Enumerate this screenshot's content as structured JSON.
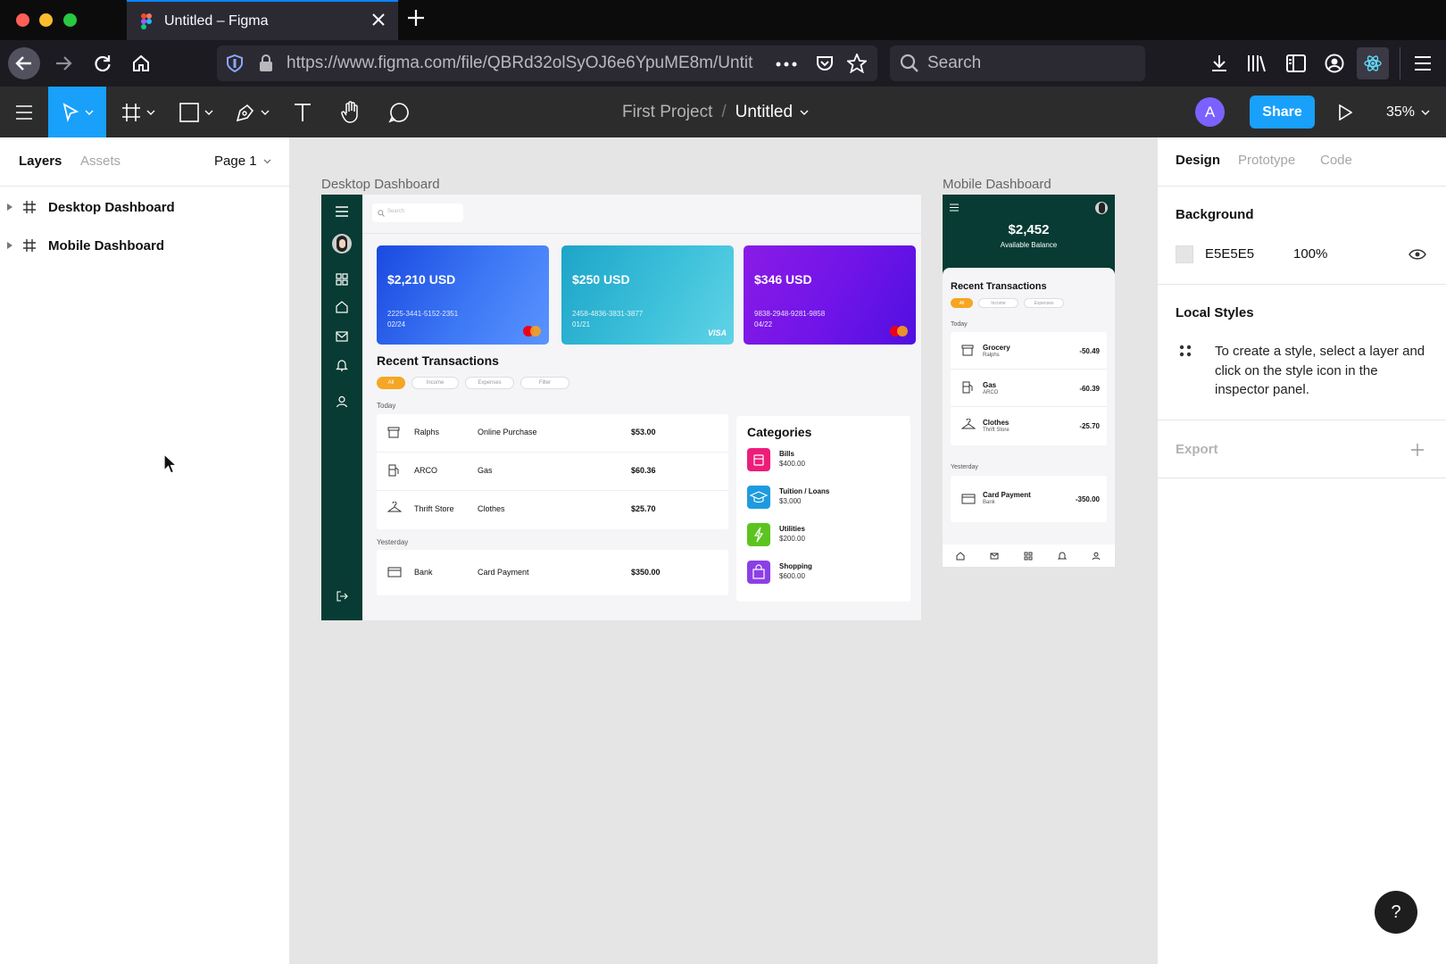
{
  "browser": {
    "tab_title": "Untitled – Figma",
    "url": "https://www.figma.com/file/QBRd32olSyOJ6e6YpuME8m/Untit",
    "url_host": "www.figma.com",
    "search_placeholder": "Search"
  },
  "figma_toolbar": {
    "project": "First Project",
    "separator": "/",
    "file_name": "Untitled",
    "avatar_letter": "A",
    "share_label": "Share",
    "zoom": "35%"
  },
  "left_panel": {
    "tabs": [
      "Layers",
      "Assets"
    ],
    "page": "Page 1",
    "layers": [
      "Desktop Dashboard",
      "Mobile Dashboard"
    ]
  },
  "right_panel": {
    "tabs": [
      "Design",
      "Prototype",
      "Code"
    ],
    "background_heading": "Background",
    "background_hex": "E5E5E5",
    "background_opacity": "100%",
    "local_styles_heading": "Local Styles",
    "local_styles_hint": "To create a style, select a layer and click on the style icon in the inspector panel.",
    "export_heading": "Export",
    "help": "?"
  },
  "canvas": {
    "frame_labels": [
      "Desktop Dashboard",
      "Mobile Dashboard"
    ],
    "background_color": "#e5e5e5"
  },
  "desktop": {
    "search_placeholder": "Search",
    "cards": [
      {
        "amount": "$2,210 USD",
        "number": "2225-3441-5152-2351",
        "expiry": "02/24",
        "brand": "mastercard"
      },
      {
        "amount": "$250 USD",
        "number": "2458-4836-3831-3877",
        "expiry": "01/21",
        "brand": "VISA"
      },
      {
        "amount": "$346 USD",
        "number": "9838-2948-9281-9858",
        "expiry": "04/22",
        "brand": "mastercard"
      }
    ],
    "recent_title": "Recent Transactions",
    "filters": [
      "All",
      "Income",
      "Expenses",
      "Filter"
    ],
    "today_label": "Today",
    "yesterday_label": "Yesterday",
    "today": [
      {
        "merchant": "Ralphs",
        "type": "Online Purchase",
        "amount": "$53.00"
      },
      {
        "merchant": "ARCO",
        "type": "Gas",
        "amount": "$60.36"
      },
      {
        "merchant": "Thrift Store",
        "type": "Clothes",
        "amount": "$25.70"
      }
    ],
    "yesterday": [
      {
        "merchant": "Bank",
        "type": "Card Payment",
        "amount": "$350.00"
      }
    ],
    "categories_title": "Categories",
    "categories": [
      {
        "name": "Bills",
        "amount": "$400.00",
        "color": "#ec1e79"
      },
      {
        "name": "Tuition / Loans",
        "amount": "$3,000",
        "color": "#1e9be0"
      },
      {
        "name": "Utilities",
        "amount": "$200.00",
        "color": "#5cc41f"
      },
      {
        "name": "Shopping",
        "amount": "$600.00",
        "color": "#8b3fe6"
      }
    ]
  },
  "mobile": {
    "balance": "$2,452",
    "balance_label": "Available Balance",
    "recent_title": "Recent Transactions",
    "filters": [
      "All",
      "Income",
      "Expenses"
    ],
    "today_label": "Today",
    "yesterday_label": "Yesterday",
    "today": [
      {
        "name": "Grocery",
        "merchant": "Ralphs",
        "amount": "-50.49"
      },
      {
        "name": "Gas",
        "merchant": "ARCO",
        "amount": "-60.39"
      },
      {
        "name": "Clothes",
        "merchant": "Thrift Store",
        "amount": "-25.70"
      }
    ],
    "yesterday": [
      {
        "name": "Card Payment",
        "merchant": "Bank",
        "amount": "-350.00"
      }
    ]
  }
}
